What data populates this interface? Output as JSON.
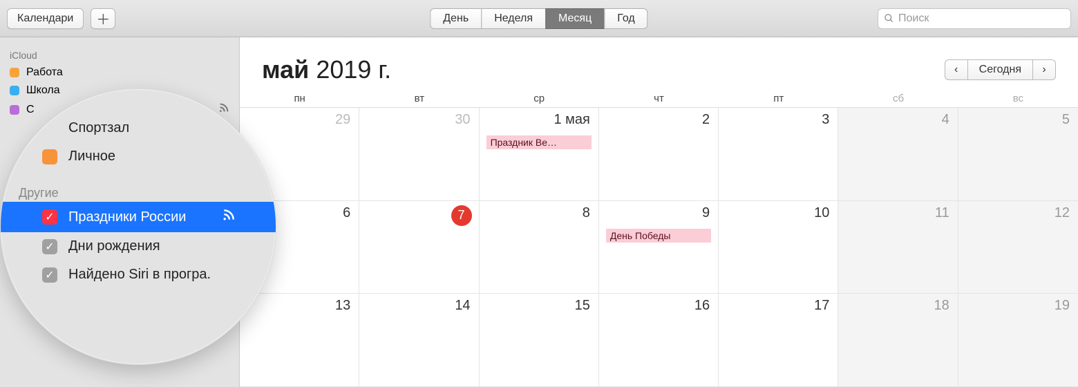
{
  "toolbar": {
    "calendars_button": "Календари",
    "views": [
      "День",
      "Неделя",
      "Месяц",
      "Год"
    ],
    "active_view_index": 2,
    "search_placeholder": "Поиск"
  },
  "sidebar": {
    "section1": "iCloud",
    "items": [
      {
        "label": "Работа",
        "color": "orange"
      },
      {
        "label": "Школа",
        "color": "blue"
      },
      {
        "label": "С",
        "color": "purple",
        "rss": true
      }
    ]
  },
  "magnifier": {
    "top_items": [
      {
        "label": "Спортзал"
      },
      {
        "label": "Личное",
        "swatch": "orange"
      }
    ],
    "section": "Другие",
    "items": [
      {
        "label": "Праздники России",
        "checkbox": "red",
        "selected": true,
        "rss": true
      },
      {
        "label": "Дни рождения",
        "checkbox": "grey"
      },
      {
        "label": "Найдено Siri в програ.",
        "checkbox": "grey"
      }
    ]
  },
  "calendar": {
    "month_bold": "май",
    "month_rest": " 2019 г.",
    "today_label": "Сегодня",
    "dow": [
      "пн",
      "вт",
      "ср",
      "чт",
      "пт",
      "сб",
      "вс"
    ],
    "weeks": [
      [
        {
          "num": "29",
          "out": true
        },
        {
          "num": "30",
          "out": true
        },
        {
          "num": "1 мая",
          "first": true,
          "event": "Праздник Ве…"
        },
        {
          "num": "2"
        },
        {
          "num": "3"
        },
        {
          "num": "4",
          "wkend": true
        },
        {
          "num": "5",
          "wkend": true
        }
      ],
      [
        {
          "num": "6"
        },
        {
          "num": "7",
          "today": true
        },
        {
          "num": "8"
        },
        {
          "num": "9",
          "event": "День Победы"
        },
        {
          "num": "10"
        },
        {
          "num": "11",
          "wkend": true
        },
        {
          "num": "12",
          "wkend": true
        }
      ],
      [
        {
          "num": "13"
        },
        {
          "num": "14"
        },
        {
          "num": "15"
        },
        {
          "num": "16"
        },
        {
          "num": "17"
        },
        {
          "num": "18",
          "wkend": true
        },
        {
          "num": "19",
          "wkend": true
        }
      ]
    ]
  }
}
